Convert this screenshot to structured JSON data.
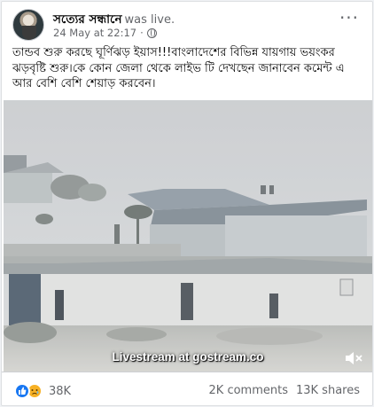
{
  "post": {
    "author": "সত্যের সন্ধানে",
    "suffix": "was live.",
    "timestamp": "24 May at 22:17",
    "separator": "·",
    "privacy_icon": "globe-icon",
    "more_icon": "more-options-icon",
    "text": "তান্ডব শুরু করছে ঘূর্ণিঝড় ইয়াস!!!বাংলাদেশের বিভিন্ন যায়গায় ভয়ংকর ঝড়বৃষ্টি শুরু।কে কোন জেলা থেকে লাইভ টি দেখছেন জানাবেন কমেন্ট এ আর বেশি বেশি শেয়াড় করবেন।"
  },
  "video": {
    "watermark": "Livestream at gostream.co",
    "mute_icon": "speaker-muted-icon"
  },
  "footer": {
    "reaction_icons": [
      "like-icon",
      "sad-icon"
    ],
    "reaction_count": "38K",
    "comments": "2K comments",
    "shares": "13K shares"
  },
  "colors": {
    "link_blue": "#1877f2",
    "secondary_text": "#65676b",
    "sad_yellow": "#f7b125"
  }
}
